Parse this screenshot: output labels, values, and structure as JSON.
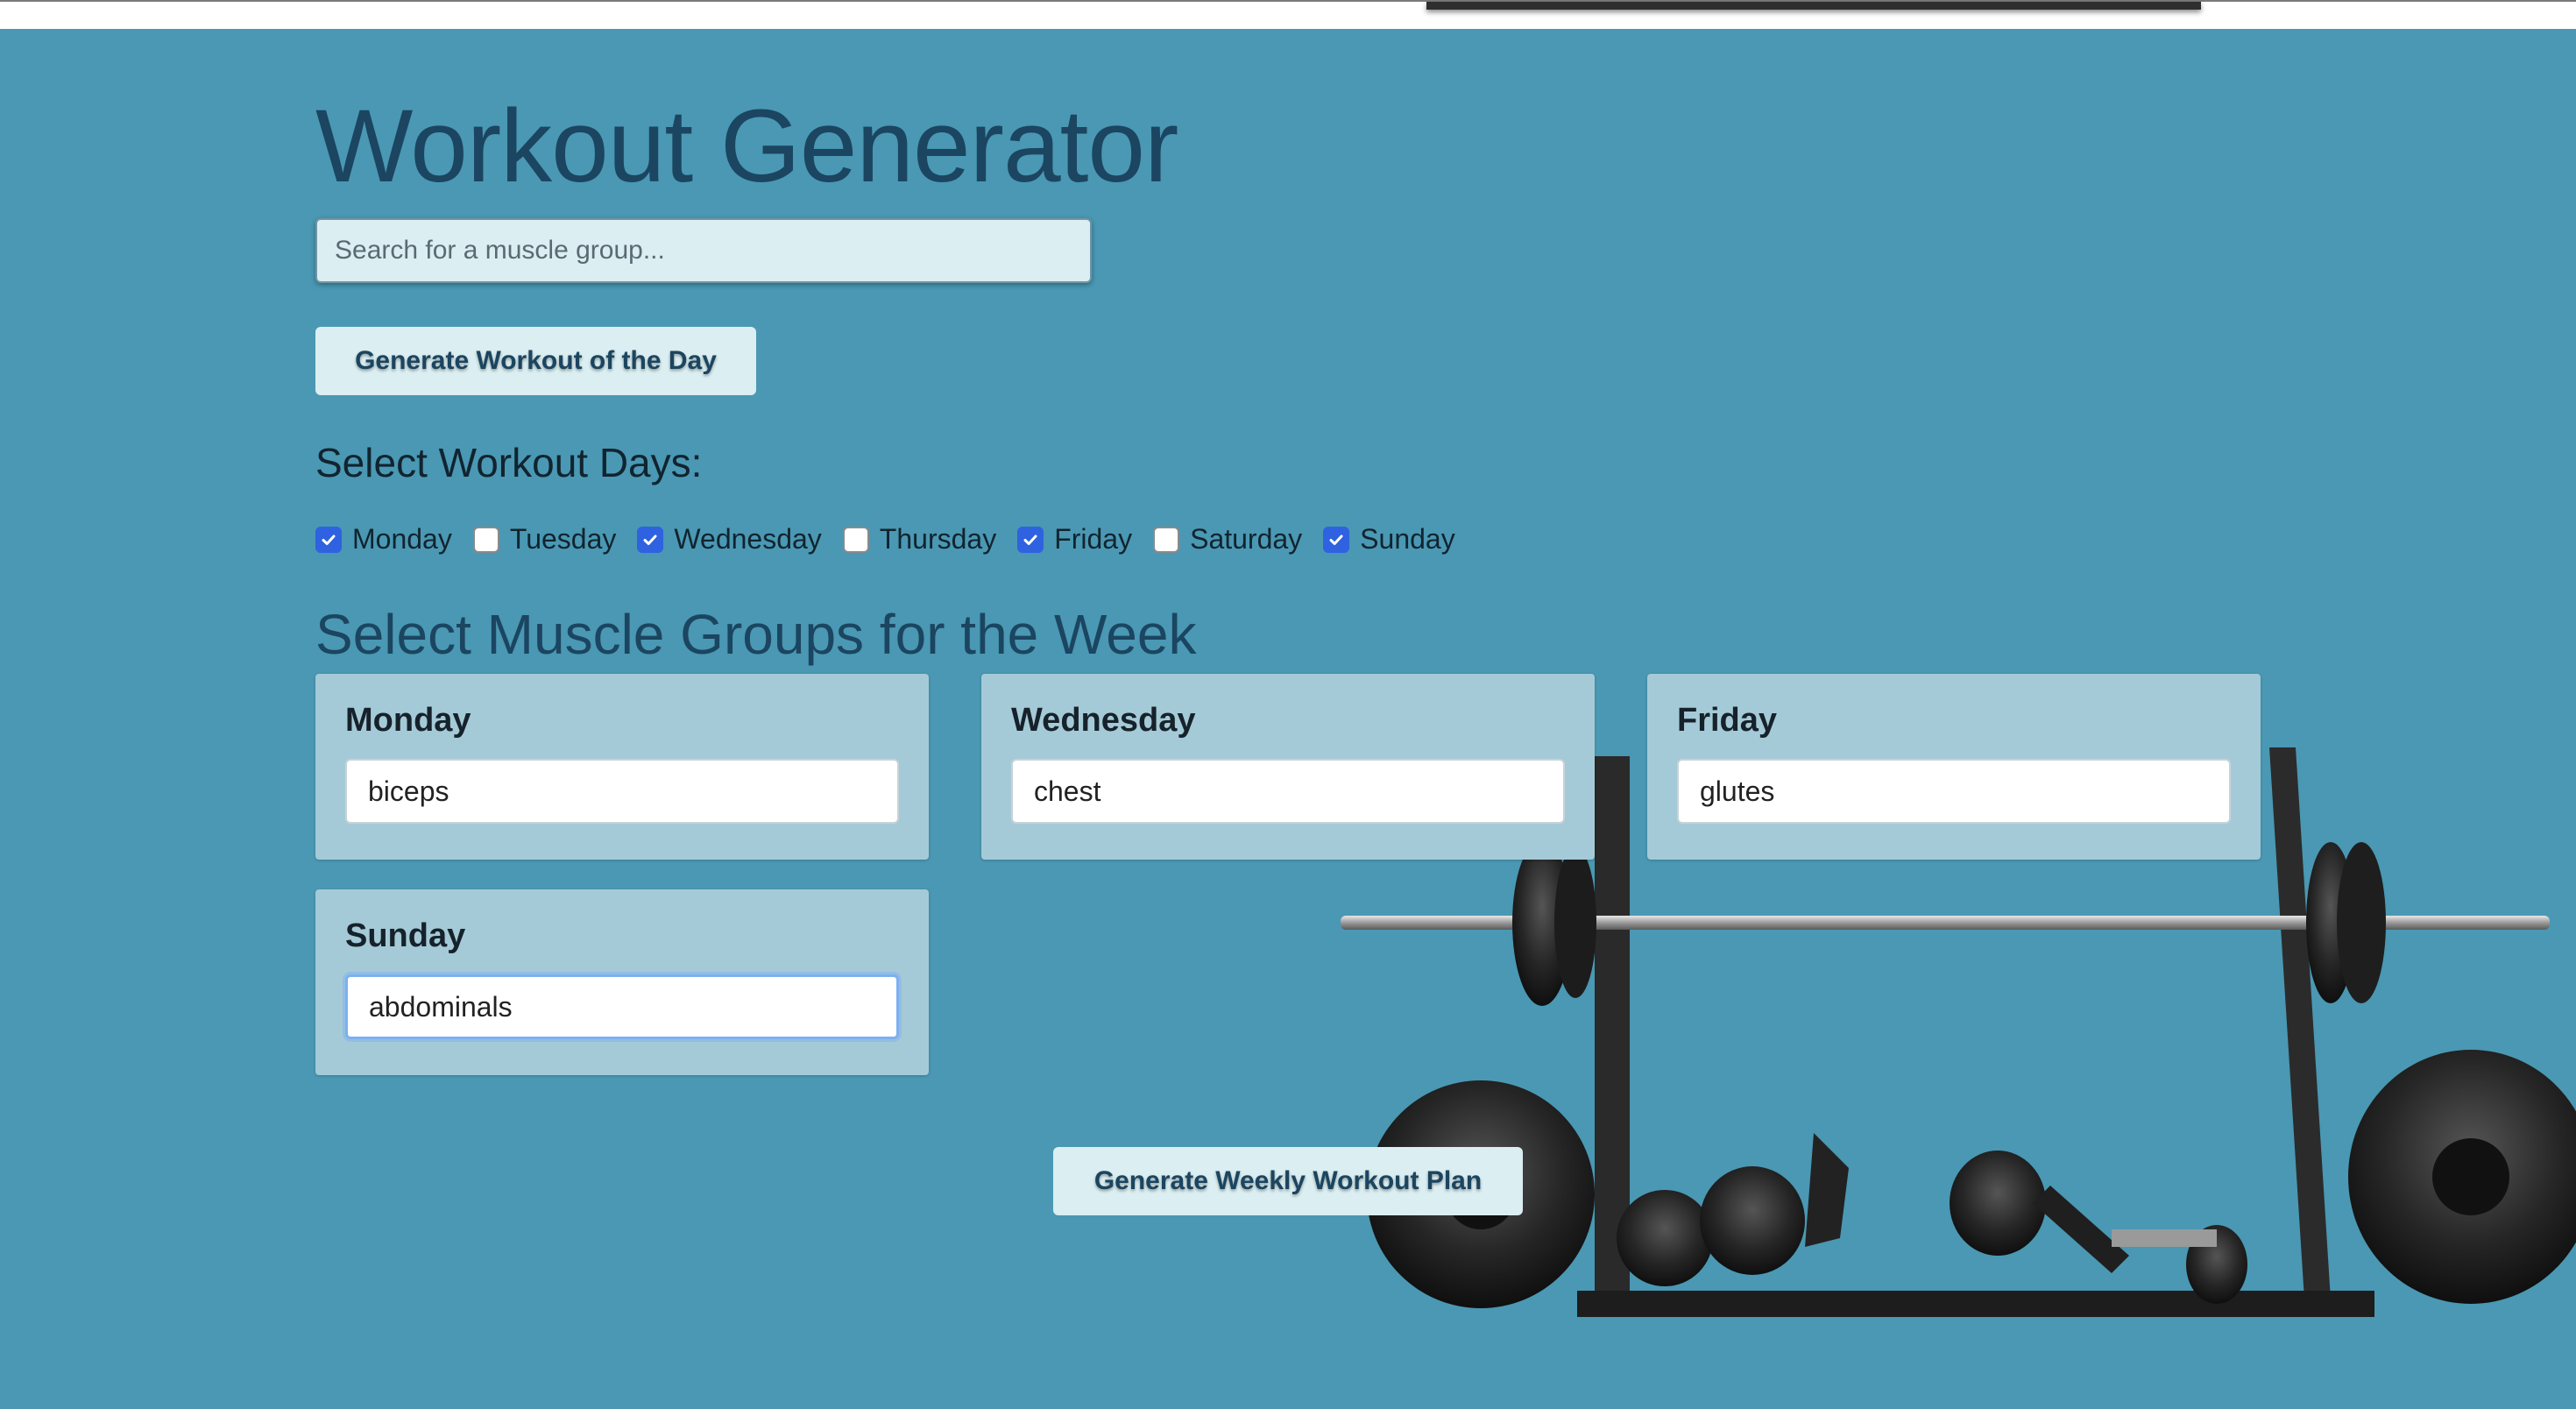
{
  "app": {
    "title": "Workout Generator"
  },
  "search": {
    "placeholder": "Search for a muscle group..."
  },
  "buttons": {
    "workout_of_the_day": "Generate Workout of the Day",
    "weekly_plan": "Generate Weekly Workout Plan"
  },
  "days_section": {
    "heading": "Select Workout Days:",
    "days": [
      {
        "label": "Monday",
        "checked": true
      },
      {
        "label": "Tuesday",
        "checked": false
      },
      {
        "label": "Wednesday",
        "checked": true
      },
      {
        "label": "Thursday",
        "checked": false
      },
      {
        "label": "Friday",
        "checked": true
      },
      {
        "label": "Saturday",
        "checked": false
      },
      {
        "label": "Sunday",
        "checked": true
      }
    ]
  },
  "muscle_section": {
    "heading": "Select Muscle Groups for the Week",
    "cards": [
      {
        "day": "Monday",
        "value": "biceps"
      },
      {
        "day": "Wednesday",
        "value": "chest"
      },
      {
        "day": "Friday",
        "value": "glutes"
      },
      {
        "day": "Sunday",
        "value": "abdominals",
        "focused": true
      }
    ]
  },
  "colors": {
    "page_background": "#4a98b3",
    "heading_text": "#1b4560",
    "button_background": "#dbeef1",
    "card_background": "#a5cad7",
    "checkbox_checked": "#2f62e0"
  },
  "icons": {
    "checkbox_check": "checkmark-icon",
    "background_art": "barbell-rack-image"
  }
}
